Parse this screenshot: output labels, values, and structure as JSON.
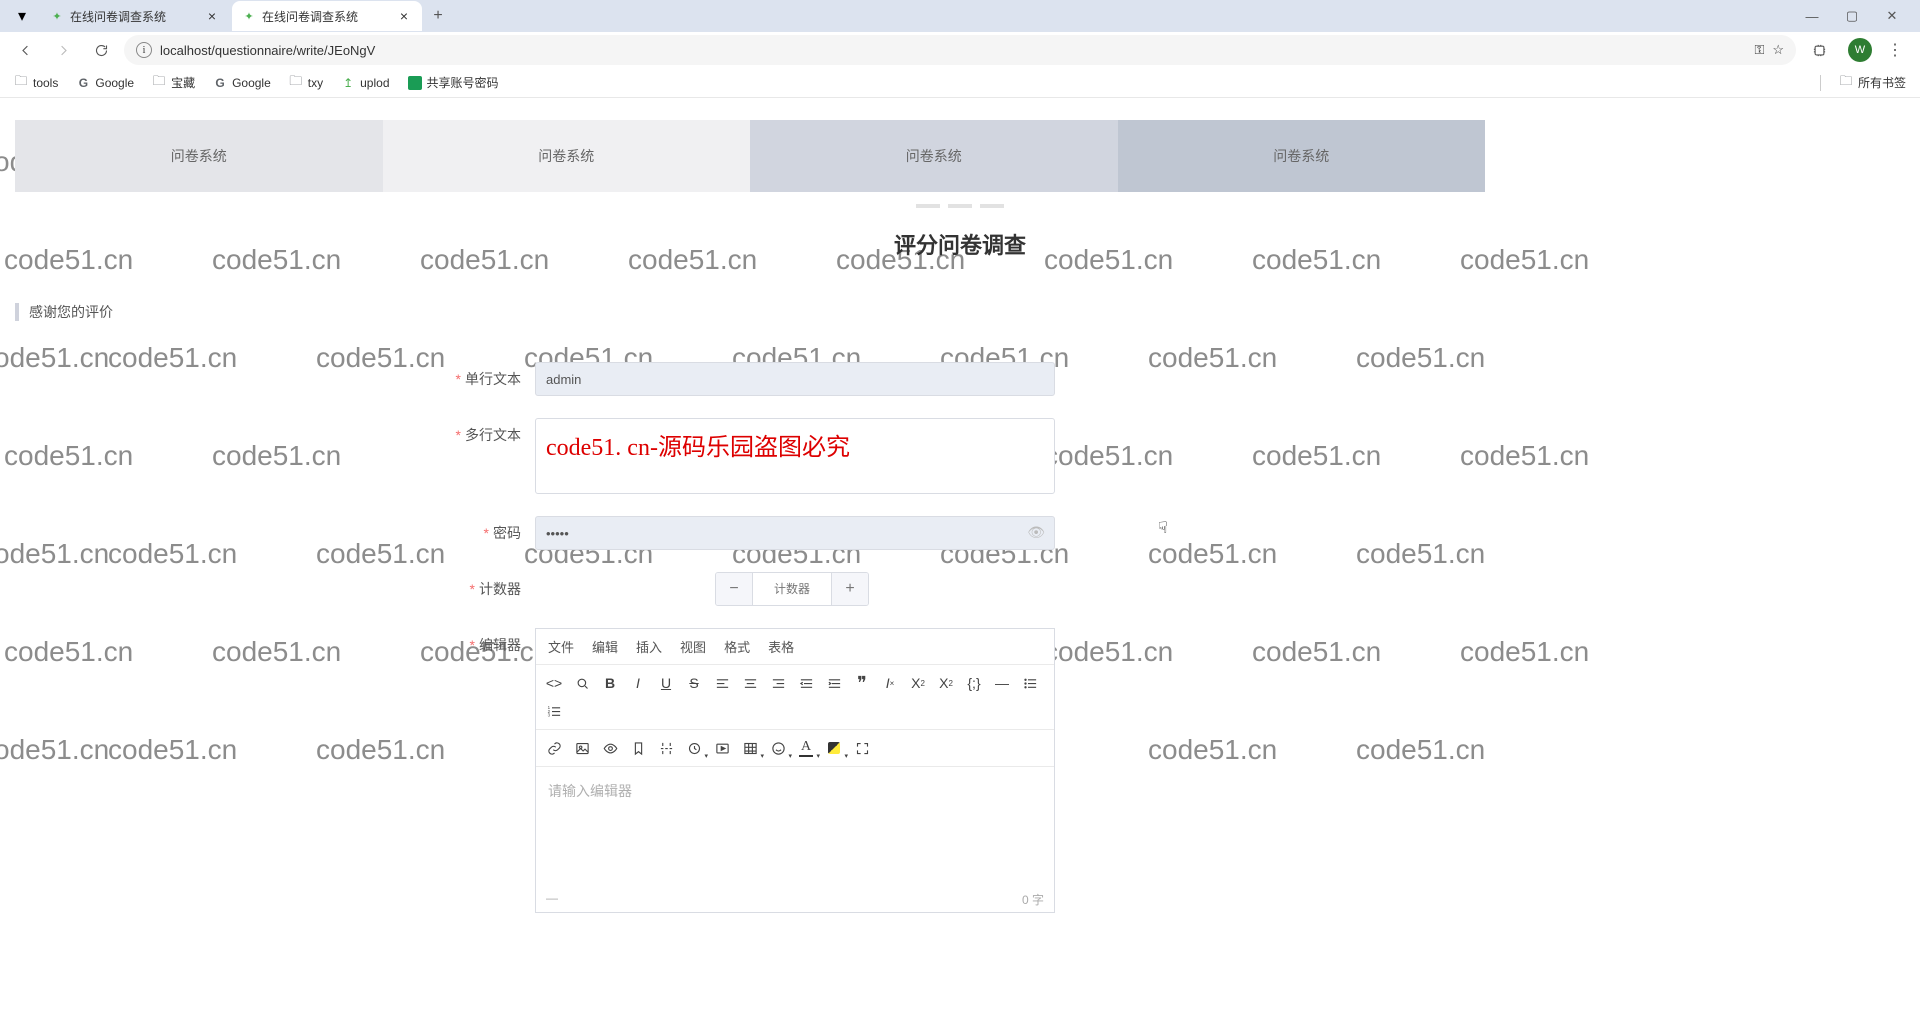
{
  "browser": {
    "tabs": [
      {
        "title": "在线问卷调查系统"
      },
      {
        "title": "在线问卷调查系统"
      }
    ],
    "url": "localhost/questionnaire/write/JEoNgV",
    "avatar_letter": "W",
    "bookmarks": [
      {
        "label": "tools",
        "icon": "folder"
      },
      {
        "label": "Google",
        "icon": "G"
      },
      {
        "label": "宝藏",
        "icon": "folder"
      },
      {
        "label": "Google",
        "icon": "G"
      },
      {
        "label": "txy",
        "icon": "folder"
      },
      {
        "label": "uplod",
        "icon": "up"
      },
      {
        "label": "共享账号密码",
        "icon": "sheet"
      }
    ],
    "all_bookmarks_label": "所有书签"
  },
  "watermark": "code51.cn",
  "page": {
    "tabs": [
      {
        "label": "问卷系统"
      },
      {
        "label": "问卷系统"
      },
      {
        "label": "问卷系统"
      },
      {
        "label": "问卷系统"
      }
    ],
    "title": "评分问卷调查",
    "section_text": "感谢您的评价",
    "form": {
      "single_line": {
        "label": "单行文本",
        "value": "admin"
      },
      "multi_line": {
        "label": "多行文本",
        "value": "code51. cn-源码乐园盗图必究"
      },
      "password": {
        "label": "密码",
        "value": "•••••"
      },
      "counter": {
        "label": "计数器",
        "placeholder": "计数器"
      },
      "editor": {
        "label": "编辑器",
        "menu": [
          "文件",
          "编辑",
          "插入",
          "视图",
          "格式",
          "表格"
        ],
        "placeholder": "请输入编辑器",
        "footer_left": "—",
        "footer_right": "0 字"
      }
    }
  }
}
